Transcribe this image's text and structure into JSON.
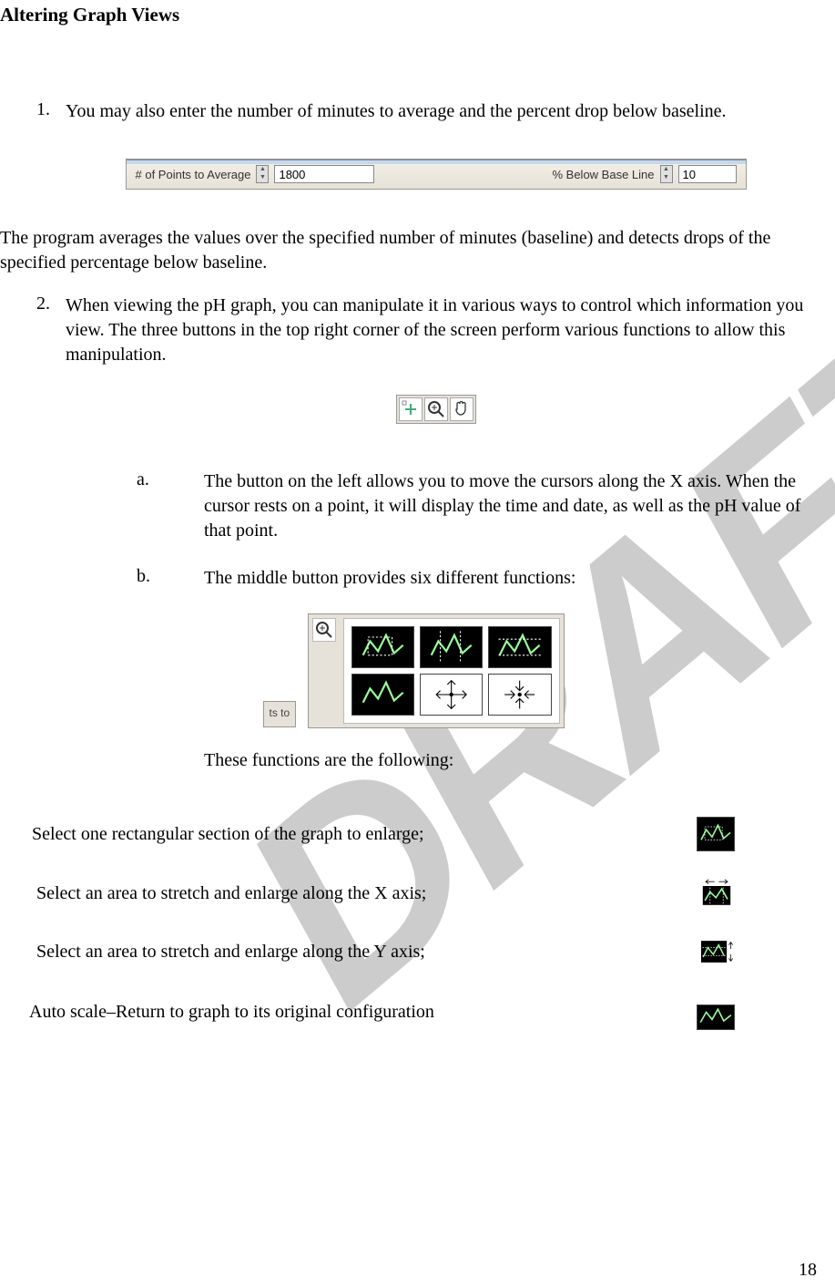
{
  "heading": "Altering Graph Views",
  "step1": {
    "num": "1.",
    "text": "You may also enter the number of minutes to average and the percent drop below baseline."
  },
  "toolbar": {
    "points_label": "# of Points to Average",
    "points_value": "1800",
    "below_label": "% Below Base Line",
    "below_value": "10"
  },
  "after_toolbar": "The program averages the values over the specified number of minutes (baseline) and detects drops of the specified percentage below baseline.",
  "step2": {
    "num": "2.",
    "text": "When viewing the pH graph, you can manipulate it in various ways to control which information you view.  The three buttons in the top right corner of the screen perform various functions to allow this manipulation."
  },
  "sub_a": {
    "letter": "a.",
    "text": "The button on the left allows you to move the cursors along the X axis. When the cursor rests on a point, it will display the time and date, as well as the pH value of that point."
  },
  "sub_b": {
    "letter": "b.",
    "text": "The middle button provides six different functions:"
  },
  "palette_corner": "ts to",
  "funcs_lead": "These functions are the following:",
  "func1": "Select one rectangular section of the graph to enlarge;",
  "func2": "Select an area to stretch and enlarge along the X axis;",
  "func3": "Select an area to stretch and enlarge along the Y axis;",
  "func4": "Auto scale–Return to graph to its original configuration",
  "page_num": "18"
}
